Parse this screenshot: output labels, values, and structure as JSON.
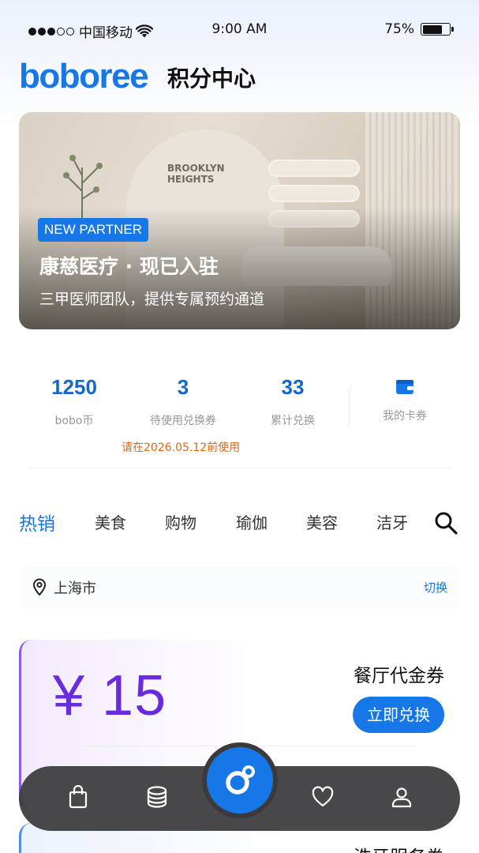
{
  "status_bar": {
    "carrier": "中国移动",
    "time": "9:00 AM",
    "battery": "75%",
    "signal_dots_filled": 3,
    "signal_dots_total": 5
  },
  "header": {
    "logo": "boboree",
    "title": "积分中心"
  },
  "banner": {
    "tag": "NEW PARTNER",
    "title": "康慈医疗 · 现已入驻",
    "subtitle": "三甲医师团队，提供专属预约通道",
    "wall_text": "BROOKLYN\nHEIGHTS"
  },
  "stats": [
    {
      "value": "1250",
      "label": "bobo币"
    },
    {
      "value": "3",
      "label": "待使用兑换券"
    },
    {
      "value": "33",
      "label": "累计兑换"
    }
  ],
  "wallet": {
    "icon": "wallet-icon",
    "label": "我的卡券"
  },
  "stat_note": "请在2026.05.12前使用",
  "tabs": [
    "热销",
    "美食",
    "购物",
    "瑜伽",
    "美容",
    "洁牙"
  ],
  "active_tab": 0,
  "location": {
    "city": "上海市",
    "switch_label": "切换"
  },
  "coupons": [
    {
      "amount": "¥ 15",
      "title": "餐厅代金券",
      "button": "立即兑换"
    },
    {
      "title": "洗牙服务券"
    }
  ],
  "bottom_nav": {
    "items": [
      "bag-icon",
      "coins-icon",
      "boboree-logo-icon",
      "heart-icon",
      "profile-icon"
    ],
    "active": "boboree-logo-icon"
  },
  "colors": {
    "brand": "#1677e6",
    "stat_number": "#1668c7",
    "note": "#e2660f",
    "coupon_amount": "#6a2be0",
    "nav_bg": "#3a3a3c"
  }
}
